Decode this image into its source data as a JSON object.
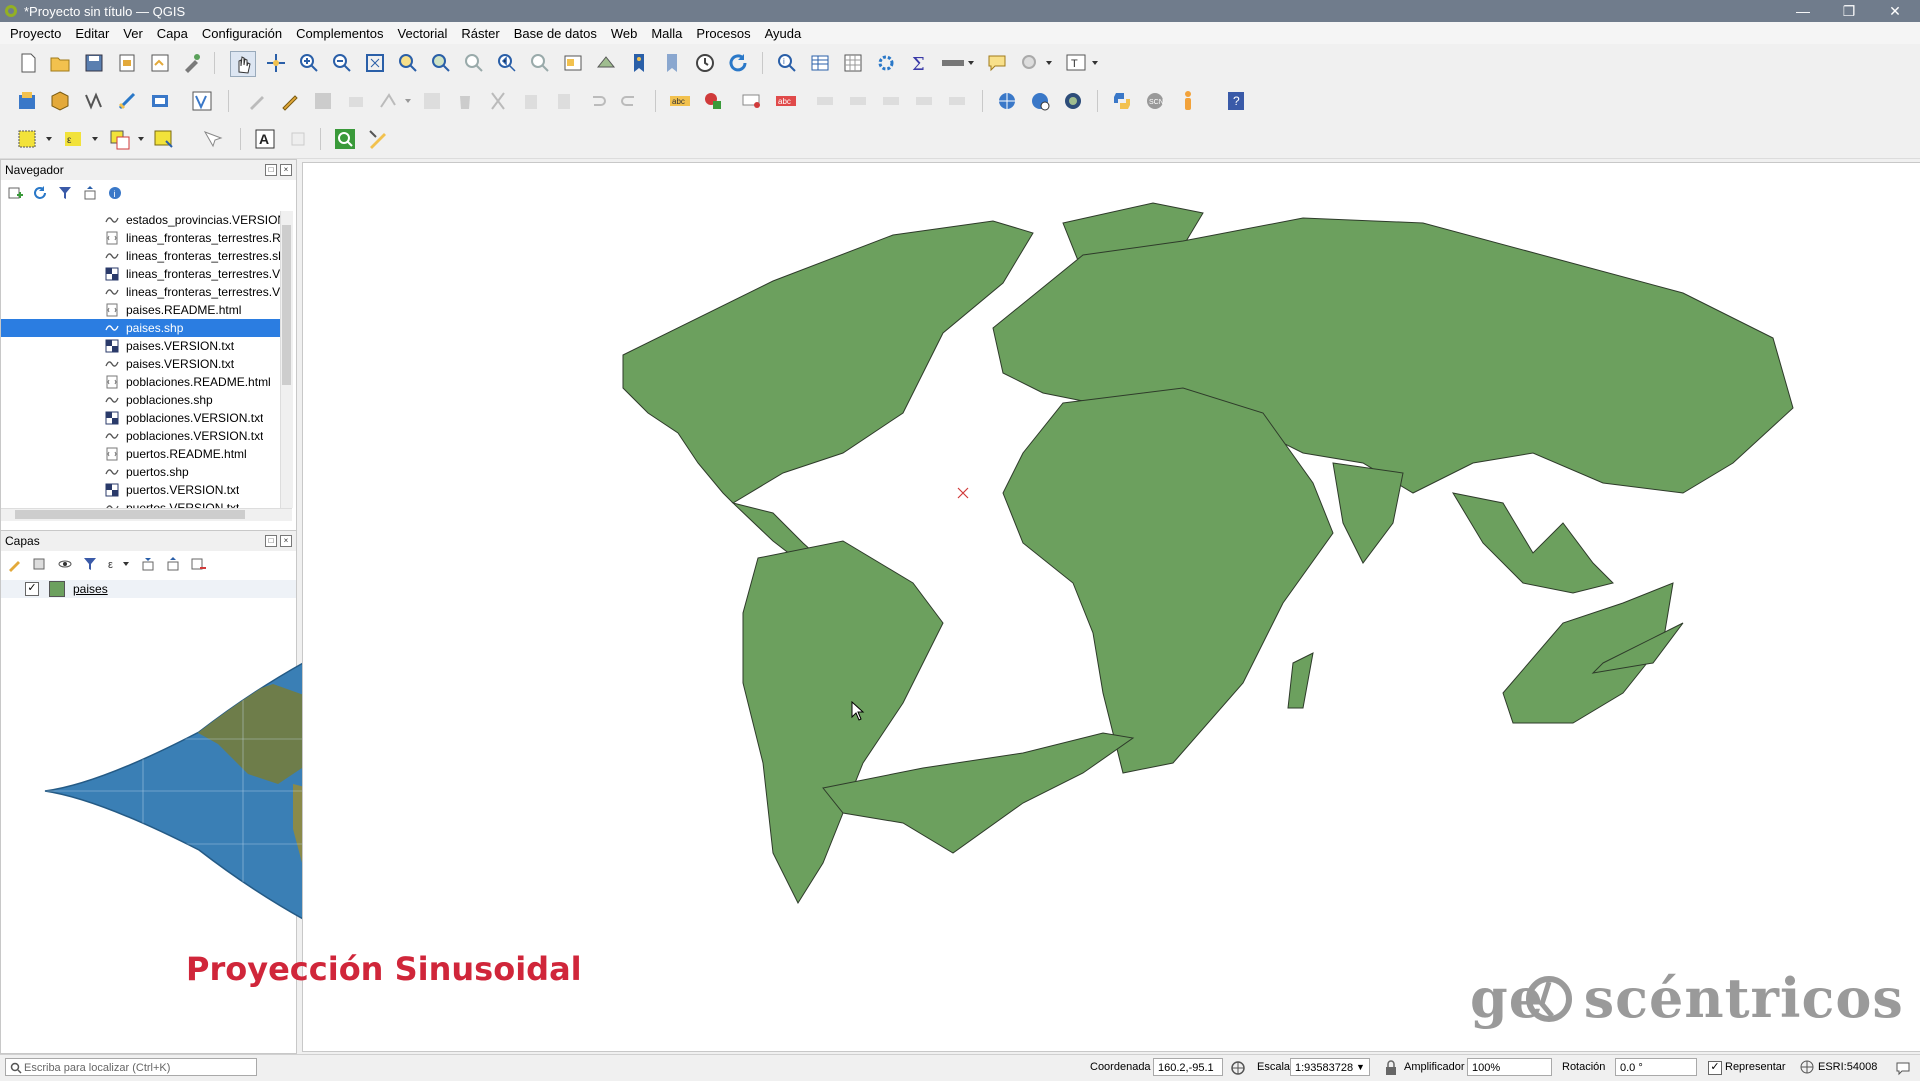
{
  "window": {
    "title": "*Proyecto sin título — QGIS"
  },
  "menu": [
    "Proyecto",
    "Editar",
    "Ver",
    "Capa",
    "Configuración",
    "Complementos",
    "Vectorial",
    "Ráster",
    "Base de datos",
    "Web",
    "Malla",
    "Procesos",
    "Ayuda"
  ],
  "navigator": {
    "title": "Navegador",
    "files": [
      {
        "name": "estados_provincias.VERSION.txt",
        "icon": "text-file-icon"
      },
      {
        "name": "lineas_fronteras_terrestres.README.html",
        "icon": "html-file-icon"
      },
      {
        "name": "lineas_fronteras_terrestres.shp",
        "icon": "vector-line-icon"
      },
      {
        "name": "lineas_fronteras_terrestres.VERSION.txt",
        "icon": "table-file-icon"
      },
      {
        "name": "lineas_fronteras_terrestres.VERSION.txt",
        "icon": "vector-line-icon"
      },
      {
        "name": "paises.README.html",
        "icon": "html-file-icon"
      },
      {
        "name": "paises.shp",
        "icon": "vector-polygon-icon",
        "selected": true
      },
      {
        "name": "paises.VERSION.txt",
        "icon": "table-file-icon"
      },
      {
        "name": "paises.VERSION.txt",
        "icon": "vector-line-icon"
      },
      {
        "name": "poblaciones.README.html",
        "icon": "html-file-icon"
      },
      {
        "name": "poblaciones.shp",
        "icon": "vector-line-icon"
      },
      {
        "name": "poblaciones.VERSION.txt",
        "icon": "table-file-icon"
      },
      {
        "name": "poblaciones.VERSION.txt",
        "icon": "vector-line-icon"
      },
      {
        "name": "puertos.README.html",
        "icon": "html-file-icon"
      },
      {
        "name": "puertos.shp",
        "icon": "vector-line-icon"
      },
      {
        "name": "puertos.VERSION.txt",
        "icon": "table-file-icon"
      },
      {
        "name": "puertos.VERSION.txt",
        "icon": "vector-line-icon"
      }
    ]
  },
  "layers": {
    "title": "Capas",
    "items": [
      {
        "name": "paises",
        "checked": true,
        "color": "#6ca05e"
      }
    ]
  },
  "overlay": {
    "caption": "Proyección Sinusoidal",
    "watermark": "ge  scéntricos"
  },
  "statusbar": {
    "locator_placeholder": "Escriba para localizar (Ctrl+K)",
    "coord_label": "Coordenada",
    "coord_value": "160.2,-95.1",
    "scale_label": "Escala",
    "scale_value": "1:93583728",
    "magnifier_label": "Amplificador",
    "magnifier_value": "100%",
    "rotation_label": "Rotación",
    "rotation_value": "0.0 °",
    "render_label": "Representar",
    "crs": "ESRI:54008"
  },
  "colors": {
    "land": "#6ca05e",
    "selection": "#2b7de1",
    "title_bar": "#707c8c",
    "caption": "#d0263a",
    "ocean": "#3a7fb5"
  }
}
